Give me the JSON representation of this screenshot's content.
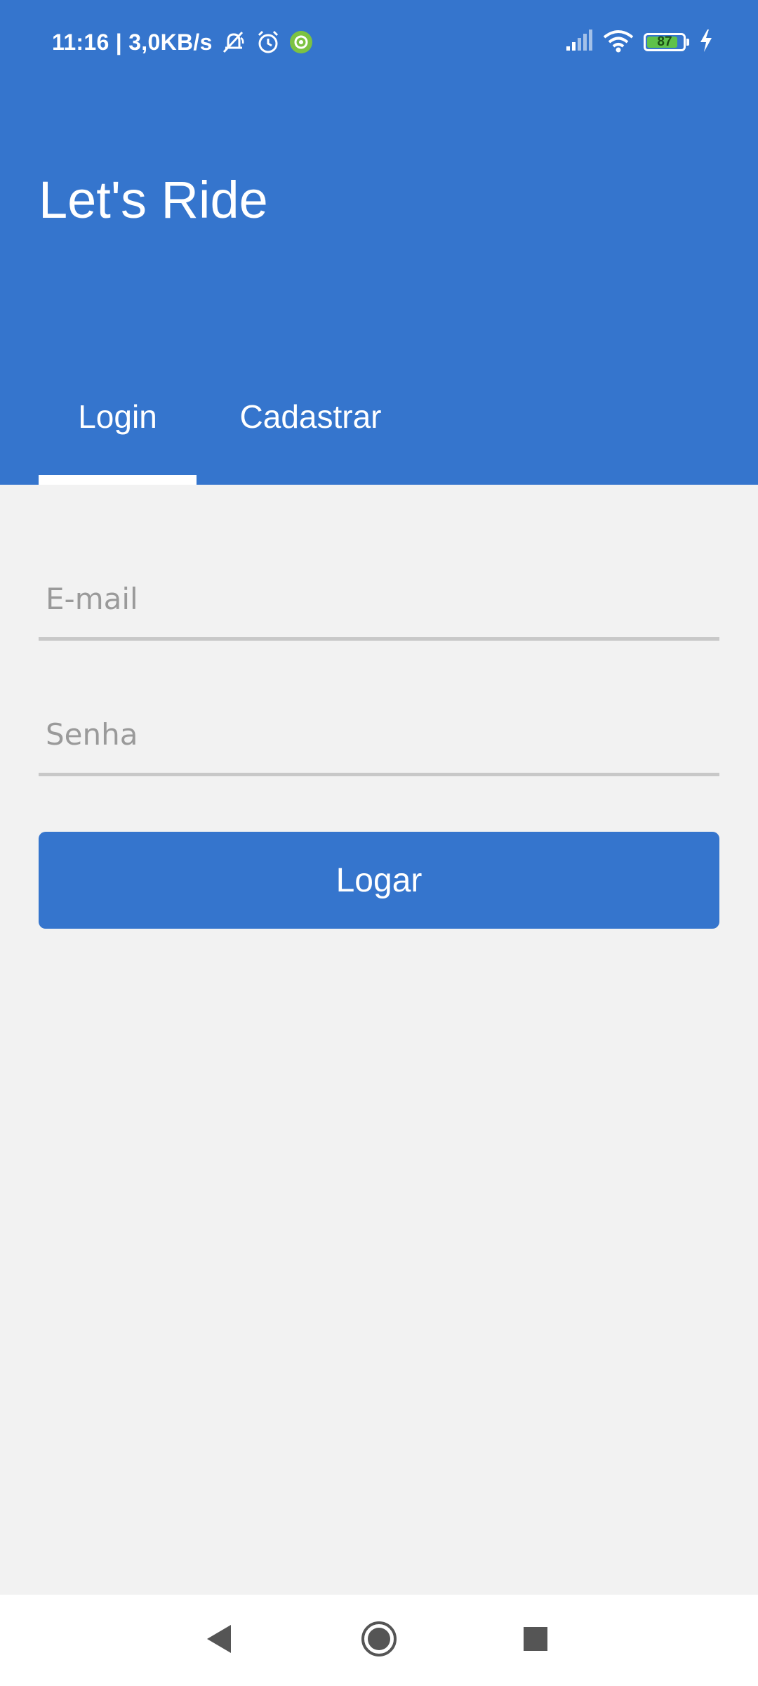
{
  "status_bar": {
    "time_speed": "11:16 | 3,0KB/s",
    "battery": "87",
    "battery_level": 0.87
  },
  "header": {
    "title": "Let's Ride",
    "tabs": [
      {
        "label": "Login",
        "selected": true
      },
      {
        "label": "Cadastrar",
        "selected": false
      }
    ]
  },
  "form": {
    "email_placeholder": "E-mail",
    "email_value": "",
    "senha_placeholder": "Senha",
    "senha_value": "",
    "submit_label": "Logar"
  },
  "colors": {
    "primary": "#3575cd",
    "background": "#f2f2f2",
    "battery_fill": "#5fc24a"
  },
  "icons": {
    "status_left": [
      "muted-bell-icon",
      "alarm-icon",
      "app-notification-icon"
    ],
    "status_right": [
      "cell-signal-icon",
      "wifi-icon",
      "battery-icon",
      "charging-bolt-icon"
    ],
    "nav": [
      "back-triangle-icon",
      "home-circle-icon",
      "recents-square-icon"
    ]
  }
}
